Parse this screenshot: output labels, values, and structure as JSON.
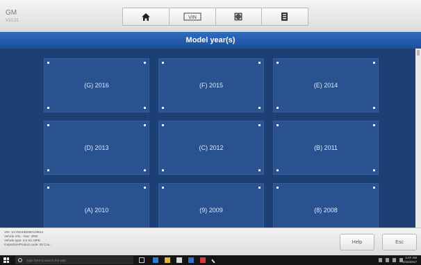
{
  "header": {
    "make": "GM",
    "version": "V10.21",
    "tools": [
      {
        "name": "home-icon"
      },
      {
        "name": "vehicle-id-icon"
      },
      {
        "name": "fullscreen-icon"
      },
      {
        "name": "database-icon"
      }
    ]
  },
  "title": "Model year(s)",
  "years": [
    {
      "label": "(G) 2016"
    },
    {
      "label": "(F) 2015"
    },
    {
      "label": "(E) 2014"
    },
    {
      "label": "(D) 2013"
    },
    {
      "label": "(C) 2012"
    },
    {
      "label": "(B) 2011"
    },
    {
      "label": "(A) 2010"
    },
    {
      "label": "(9) 2009"
    },
    {
      "label": "(8) 2008"
    }
  ],
  "info": {
    "line1": "VIN: 1GYEK63N95R109014",
    "line2": "Vehicle Info.: Year: 2005",
    "line3": "Vehicle type: 3.6 SIL MPE",
    "line4": "Inspection/Product code: 08 Cou..."
  },
  "buttons": {
    "help": "Help",
    "esc": "Esc"
  },
  "taskbar": {
    "search_placeholder": "Type here to search the web",
    "time": "1:07 AM",
    "date": "2/16/2017"
  },
  "colors": {
    "main_bg": "#1e3f73",
    "tile_bg": "#2a5290",
    "titlebar": "#2a61b2"
  }
}
